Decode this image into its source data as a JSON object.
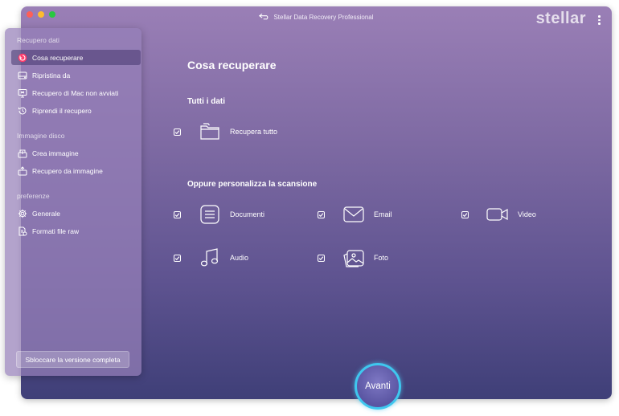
{
  "window": {
    "title": "Stellar Data Recovery Professional",
    "brand": "stellar"
  },
  "sidebar": {
    "sections": [
      {
        "label": "Recupero dati",
        "items": [
          {
            "label": "Cosa recuperare",
            "icon": "recover-icon",
            "active": true
          },
          {
            "label": "Ripristina da",
            "icon": "drive-icon",
            "active": false
          },
          {
            "label": "Recupero di Mac non avviati",
            "icon": "mac-monitor-icon",
            "active": false
          },
          {
            "label": "Riprendi il recupero",
            "icon": "history-icon",
            "active": false
          }
        ]
      },
      {
        "label": "Immagine disco",
        "items": [
          {
            "label": "Crea immagine",
            "icon": "create-image-icon",
            "active": false
          },
          {
            "label": "Recupero da immagine",
            "icon": "image-recovery-icon",
            "active": false
          }
        ]
      },
      {
        "label": "preferenze",
        "items": [
          {
            "label": "Generale",
            "icon": "gear-icon",
            "active": false
          },
          {
            "label": "Formati file raw",
            "icon": "raw-file-icon",
            "active": false
          }
        ]
      }
    ],
    "unlock_button": "Sbloccare la versione completa"
  },
  "main": {
    "title": "Cosa recuperare",
    "all_data_heading": "Tutti i dati",
    "recover_all": {
      "label": "Recupera tutto",
      "checked": true,
      "icon": "folder-icon"
    },
    "custom_heading": "Oppure personalizza la scansione",
    "options": [
      {
        "label": "Documenti",
        "checked": true,
        "icon": "document-icon"
      },
      {
        "label": "Email",
        "checked": true,
        "icon": "email-icon"
      },
      {
        "label": "Video",
        "checked": true,
        "icon": "video-icon"
      },
      {
        "label": "Audio",
        "checked": true,
        "icon": "music-icon"
      },
      {
        "label": "Foto",
        "checked": true,
        "icon": "photo-icon"
      }
    ]
  },
  "next_button": "Avanti",
  "colors": {
    "accent_ring": "#3fc7ef",
    "window_top": "#9a7fb6",
    "window_bottom": "#3f3f78"
  }
}
